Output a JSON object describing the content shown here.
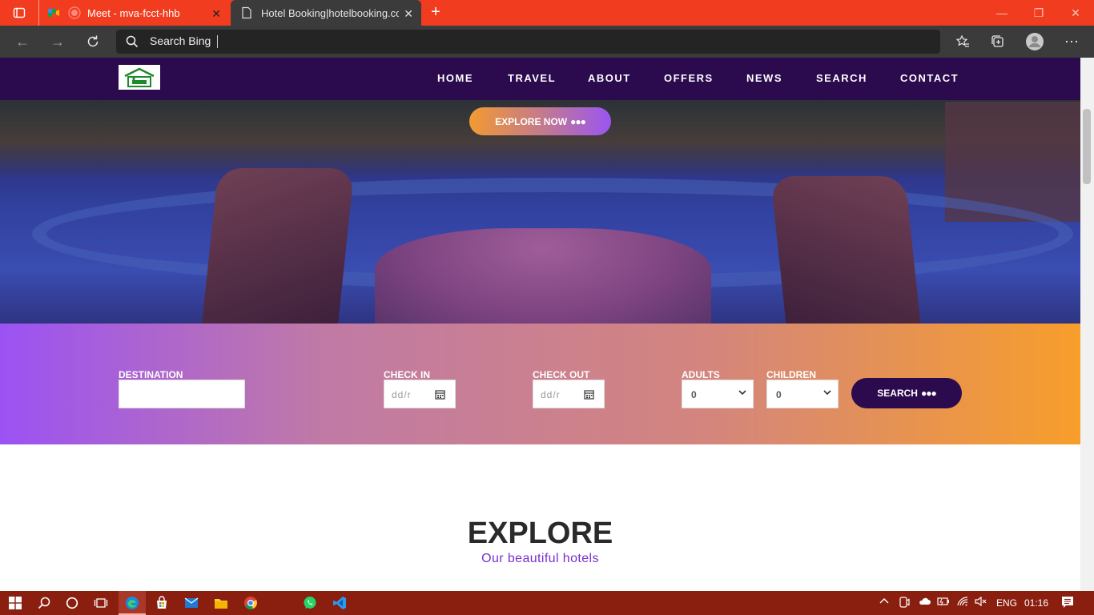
{
  "browser": {
    "tabs": [
      {
        "title": "Meet - mva-fcct-hhb",
        "active": false
      },
      {
        "title": "Hotel Booking|hotelbooking.com",
        "active": true
      }
    ],
    "new_tab_label": "+",
    "omnibox_text": "Search Bing"
  },
  "site": {
    "nav": [
      "HOME",
      "TRAVEL",
      "ABOUT",
      "OFFERS",
      "NEWS",
      "SEARCH",
      "CONTACT"
    ],
    "explore_now": "EXPLORE NOW",
    "booking": {
      "destination_label": "DESTINATION",
      "checkin_label": "CHECK IN",
      "checkout_label": "CHECK OUT",
      "adults_label": "ADULTS",
      "children_label": "CHILDREN",
      "date_placeholder": "dd/r",
      "adults_value": "0",
      "children_value": "0",
      "search_label": "SEARCH"
    },
    "explore_title": "EXPLORE",
    "explore_subtitle": "Our beautiful hotels"
  },
  "taskbar": {
    "language": "ENG",
    "time": "01:16"
  },
  "colors": {
    "nav_bg": "#2b0a4d",
    "titlebar": "#f23c1f",
    "taskbar": "#8a1f10",
    "accent_purple": "#9b52f4",
    "accent_orange": "#f79e2b"
  }
}
